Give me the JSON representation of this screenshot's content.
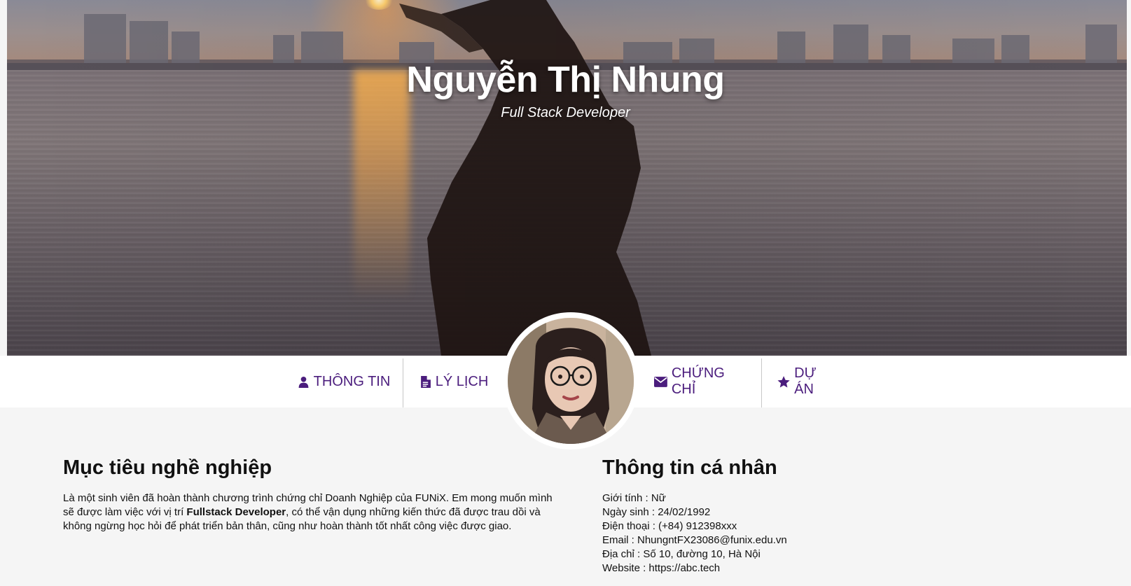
{
  "hero": {
    "name": "Nguyễn Thị Nhung",
    "role": "Full Stack Developer"
  },
  "nav": {
    "items": [
      {
        "label": "THÔNG TIN",
        "icon": "user-icon"
      },
      {
        "label": "LÝ LỊCH",
        "icon": "file-text-icon"
      },
      {
        "label": "CHỨNG CHỈ",
        "icon": "envelope-icon"
      },
      {
        "label": "DỰ ÁN",
        "icon": "star-icon"
      }
    ]
  },
  "career": {
    "title": "Mục tiêu nghề nghiệp",
    "text_before": "Là một sinh viên đã hoàn thành chương trình chứng chỉ Doanh Nghiệp của FUNiX. Em mong muốn mình sẽ được làm việc với vị trí ",
    "highlight": "Fullstack Developer",
    "text_after": ", có thể vận dụng những kiến thức đã được trau dồi và không ngừng học hỏi để phát triển bản thân, cũng như hoàn thành tốt nhất công việc được giao."
  },
  "personal": {
    "title": "Thông tin cá nhân",
    "rows": [
      "Giới tính : Nữ",
      "Ngày sinh : 24/02/1992",
      "Điện thoại : (+84) 912398xxx",
      "Email : NhungntFX23086@funix.edu.vn",
      "Địa chỉ : Số 10, đường 10, Hà Nội",
      "Website : https://abc.tech"
    ]
  },
  "colors": {
    "accent": "#4b1d7d",
    "background": "#f5f5f5",
    "nav_background": "#ffffff"
  }
}
